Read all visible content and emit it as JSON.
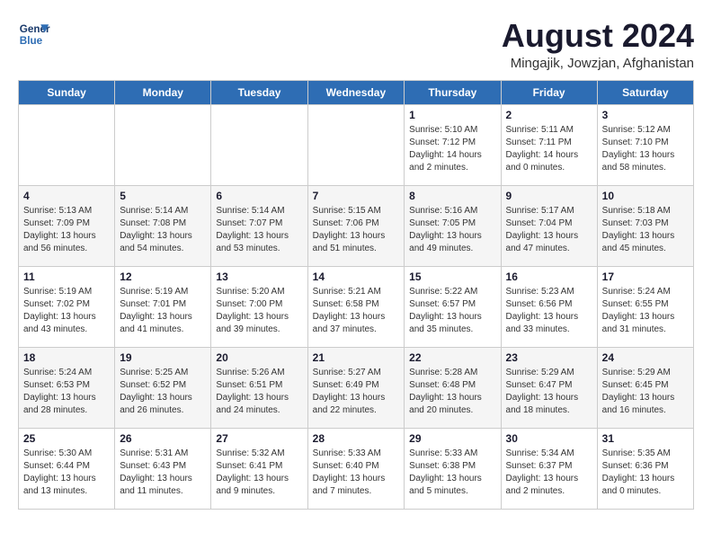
{
  "header": {
    "logo_line1": "General",
    "logo_line2": "Blue",
    "month_year": "August 2024",
    "location": "Mingajik, Jowzjan, Afghanistan"
  },
  "weekdays": [
    "Sunday",
    "Monday",
    "Tuesday",
    "Wednesday",
    "Thursday",
    "Friday",
    "Saturday"
  ],
  "weeks": [
    [
      {
        "day": "",
        "info": ""
      },
      {
        "day": "",
        "info": ""
      },
      {
        "day": "",
        "info": ""
      },
      {
        "day": "",
        "info": ""
      },
      {
        "day": "1",
        "info": "Sunrise: 5:10 AM\nSunset: 7:12 PM\nDaylight: 14 hours\nand 2 minutes."
      },
      {
        "day": "2",
        "info": "Sunrise: 5:11 AM\nSunset: 7:11 PM\nDaylight: 14 hours\nand 0 minutes."
      },
      {
        "day": "3",
        "info": "Sunrise: 5:12 AM\nSunset: 7:10 PM\nDaylight: 13 hours\nand 58 minutes."
      }
    ],
    [
      {
        "day": "4",
        "info": "Sunrise: 5:13 AM\nSunset: 7:09 PM\nDaylight: 13 hours\nand 56 minutes."
      },
      {
        "day": "5",
        "info": "Sunrise: 5:14 AM\nSunset: 7:08 PM\nDaylight: 13 hours\nand 54 minutes."
      },
      {
        "day": "6",
        "info": "Sunrise: 5:14 AM\nSunset: 7:07 PM\nDaylight: 13 hours\nand 53 minutes."
      },
      {
        "day": "7",
        "info": "Sunrise: 5:15 AM\nSunset: 7:06 PM\nDaylight: 13 hours\nand 51 minutes."
      },
      {
        "day": "8",
        "info": "Sunrise: 5:16 AM\nSunset: 7:05 PM\nDaylight: 13 hours\nand 49 minutes."
      },
      {
        "day": "9",
        "info": "Sunrise: 5:17 AM\nSunset: 7:04 PM\nDaylight: 13 hours\nand 47 minutes."
      },
      {
        "day": "10",
        "info": "Sunrise: 5:18 AM\nSunset: 7:03 PM\nDaylight: 13 hours\nand 45 minutes."
      }
    ],
    [
      {
        "day": "11",
        "info": "Sunrise: 5:19 AM\nSunset: 7:02 PM\nDaylight: 13 hours\nand 43 minutes."
      },
      {
        "day": "12",
        "info": "Sunrise: 5:19 AM\nSunset: 7:01 PM\nDaylight: 13 hours\nand 41 minutes."
      },
      {
        "day": "13",
        "info": "Sunrise: 5:20 AM\nSunset: 7:00 PM\nDaylight: 13 hours\nand 39 minutes."
      },
      {
        "day": "14",
        "info": "Sunrise: 5:21 AM\nSunset: 6:58 PM\nDaylight: 13 hours\nand 37 minutes."
      },
      {
        "day": "15",
        "info": "Sunrise: 5:22 AM\nSunset: 6:57 PM\nDaylight: 13 hours\nand 35 minutes."
      },
      {
        "day": "16",
        "info": "Sunrise: 5:23 AM\nSunset: 6:56 PM\nDaylight: 13 hours\nand 33 minutes."
      },
      {
        "day": "17",
        "info": "Sunrise: 5:24 AM\nSunset: 6:55 PM\nDaylight: 13 hours\nand 31 minutes."
      }
    ],
    [
      {
        "day": "18",
        "info": "Sunrise: 5:24 AM\nSunset: 6:53 PM\nDaylight: 13 hours\nand 28 minutes."
      },
      {
        "day": "19",
        "info": "Sunrise: 5:25 AM\nSunset: 6:52 PM\nDaylight: 13 hours\nand 26 minutes."
      },
      {
        "day": "20",
        "info": "Sunrise: 5:26 AM\nSunset: 6:51 PM\nDaylight: 13 hours\nand 24 minutes."
      },
      {
        "day": "21",
        "info": "Sunrise: 5:27 AM\nSunset: 6:49 PM\nDaylight: 13 hours\nand 22 minutes."
      },
      {
        "day": "22",
        "info": "Sunrise: 5:28 AM\nSunset: 6:48 PM\nDaylight: 13 hours\nand 20 minutes."
      },
      {
        "day": "23",
        "info": "Sunrise: 5:29 AM\nSunset: 6:47 PM\nDaylight: 13 hours\nand 18 minutes."
      },
      {
        "day": "24",
        "info": "Sunrise: 5:29 AM\nSunset: 6:45 PM\nDaylight: 13 hours\nand 16 minutes."
      }
    ],
    [
      {
        "day": "25",
        "info": "Sunrise: 5:30 AM\nSunset: 6:44 PM\nDaylight: 13 hours\nand 13 minutes."
      },
      {
        "day": "26",
        "info": "Sunrise: 5:31 AM\nSunset: 6:43 PM\nDaylight: 13 hours\nand 11 minutes."
      },
      {
        "day": "27",
        "info": "Sunrise: 5:32 AM\nSunset: 6:41 PM\nDaylight: 13 hours\nand 9 minutes."
      },
      {
        "day": "28",
        "info": "Sunrise: 5:33 AM\nSunset: 6:40 PM\nDaylight: 13 hours\nand 7 minutes."
      },
      {
        "day": "29",
        "info": "Sunrise: 5:33 AM\nSunset: 6:38 PM\nDaylight: 13 hours\nand 5 minutes."
      },
      {
        "day": "30",
        "info": "Sunrise: 5:34 AM\nSunset: 6:37 PM\nDaylight: 13 hours\nand 2 minutes."
      },
      {
        "day": "31",
        "info": "Sunrise: 5:35 AM\nSunset: 6:36 PM\nDaylight: 13 hours\nand 0 minutes."
      }
    ]
  ]
}
